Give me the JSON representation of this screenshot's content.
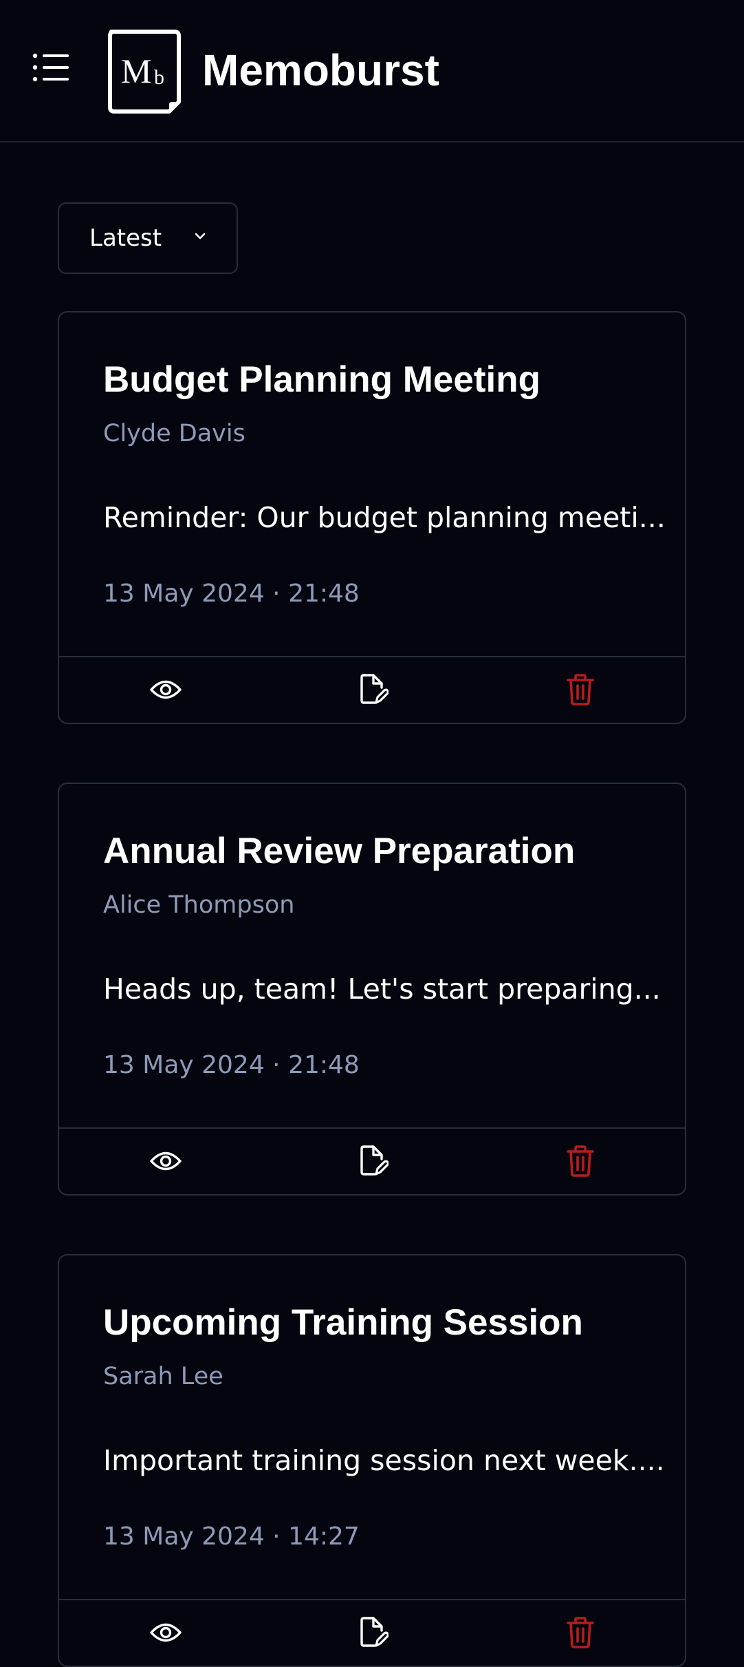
{
  "app": {
    "title": "Memoburst",
    "logo_text": "Mb"
  },
  "sort": {
    "selected": "Latest"
  },
  "colors": {
    "background": "#04050f",
    "border": "#2a2e3b",
    "muted_text": "#8f9ab8",
    "delete_red": "#b91c1c"
  },
  "icons": {
    "menu": "menu-list-icon",
    "view": "eye-icon",
    "edit": "edit-document-icon",
    "delete": "trash-icon",
    "dropdown": "chevron-down-icon"
  },
  "memos": [
    {
      "title": "Budget Planning Meeting",
      "author": "Clyde Davis",
      "excerpt": "Reminder: Our budget planning meeti...",
      "date": "13 May 2024 · 21:48"
    },
    {
      "title": "Annual Review Preparation",
      "author": "Alice Thompson",
      "excerpt": "Heads up, team! Let's start preparing...",
      "date": "13 May 2024 · 21:48"
    },
    {
      "title": "Upcoming Training Session",
      "author": "Sarah Lee",
      "excerpt": "Important training session next week....",
      "date": "13 May 2024 · 14:27"
    }
  ]
}
